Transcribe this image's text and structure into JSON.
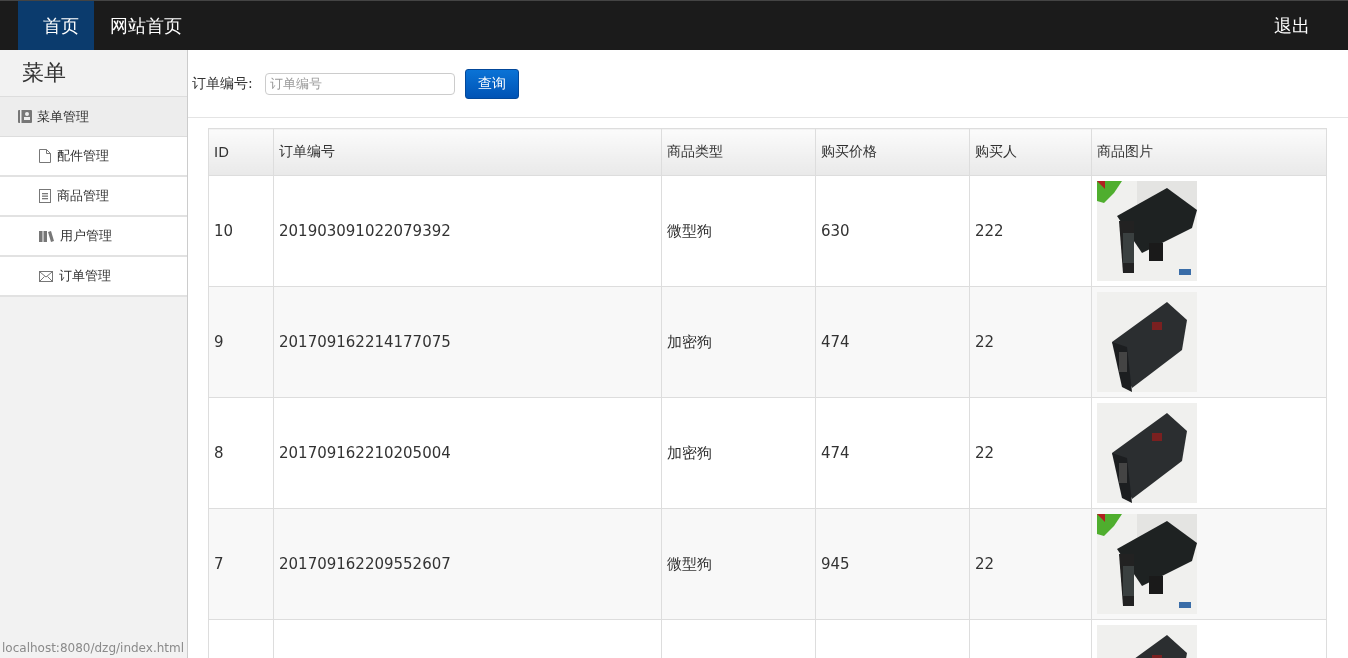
{
  "navbar": {
    "tabs": [
      {
        "label": "首页",
        "selected": true
      },
      {
        "label": "网站首页",
        "selected": false
      }
    ],
    "logout": "退出"
  },
  "sidebar": {
    "title": "菜单",
    "group": "菜单管理",
    "items": [
      {
        "label": "配件管理"
      },
      {
        "label": "商品管理"
      },
      {
        "label": "用户管理"
      },
      {
        "label": "订单管理"
      }
    ]
  },
  "search": {
    "label": "订单编号:",
    "placeholder": "订单编号",
    "button": "查询"
  },
  "table": {
    "columns": [
      "ID",
      "订单编号",
      "商品类型",
      "购买价格",
      "购买人",
      "商品图片"
    ],
    "rows": [
      {
        "cells": [
          "10",
          "201903091022079392",
          "微型狗",
          "630",
          "222"
        ],
        "image": {
          "kind": "picture"
        }
      },
      {
        "cells": [
          "9",
          "201709162214177075",
          "加密狗",
          "474",
          "22"
        ],
        "image": {
          "kind": "picture"
        }
      },
      {
        "cells": [
          "8",
          "201709162210205004",
          "加密狗",
          "474",
          "22"
        ],
        "image": {
          "kind": "picture"
        }
      },
      {
        "cells": [
          "7",
          "201709162209552607",
          "微型狗",
          "945",
          "22"
        ],
        "image": {
          "kind": "picture"
        }
      },
      {
        "cells": [],
        "image": {
          "kind": "picture"
        }
      }
    ]
  },
  "status_bar": "localhost:8080/dzg/index.html"
}
